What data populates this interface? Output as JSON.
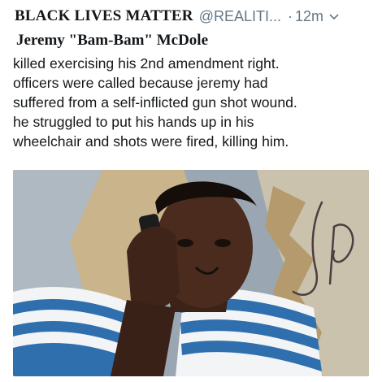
{
  "tweet": {
    "author_name": "BLACK LIVES MATTER",
    "handle": "@REALITI...",
    "separator": "·",
    "time": "12m",
    "subtitle": "Jeremy \"Bam-Bam\" McDole",
    "lines": [
      "killed exercising his 2nd amendment right.",
      "officers were called because jeremy had",
      "suffered from a self-inflicted gun shot wound.",
      "he struggled to put his hands up in his",
      "wheelchair and shots were fired, killing him."
    ],
    "caret_icon": "chevron-down-icon",
    "photo_signature": "JP"
  },
  "colors": {
    "text": "#14171a",
    "secondary": "#657786",
    "stripe_blue": "#2f6fae",
    "stripe_white": "#f2f4f6",
    "skin": "#3b2318"
  }
}
